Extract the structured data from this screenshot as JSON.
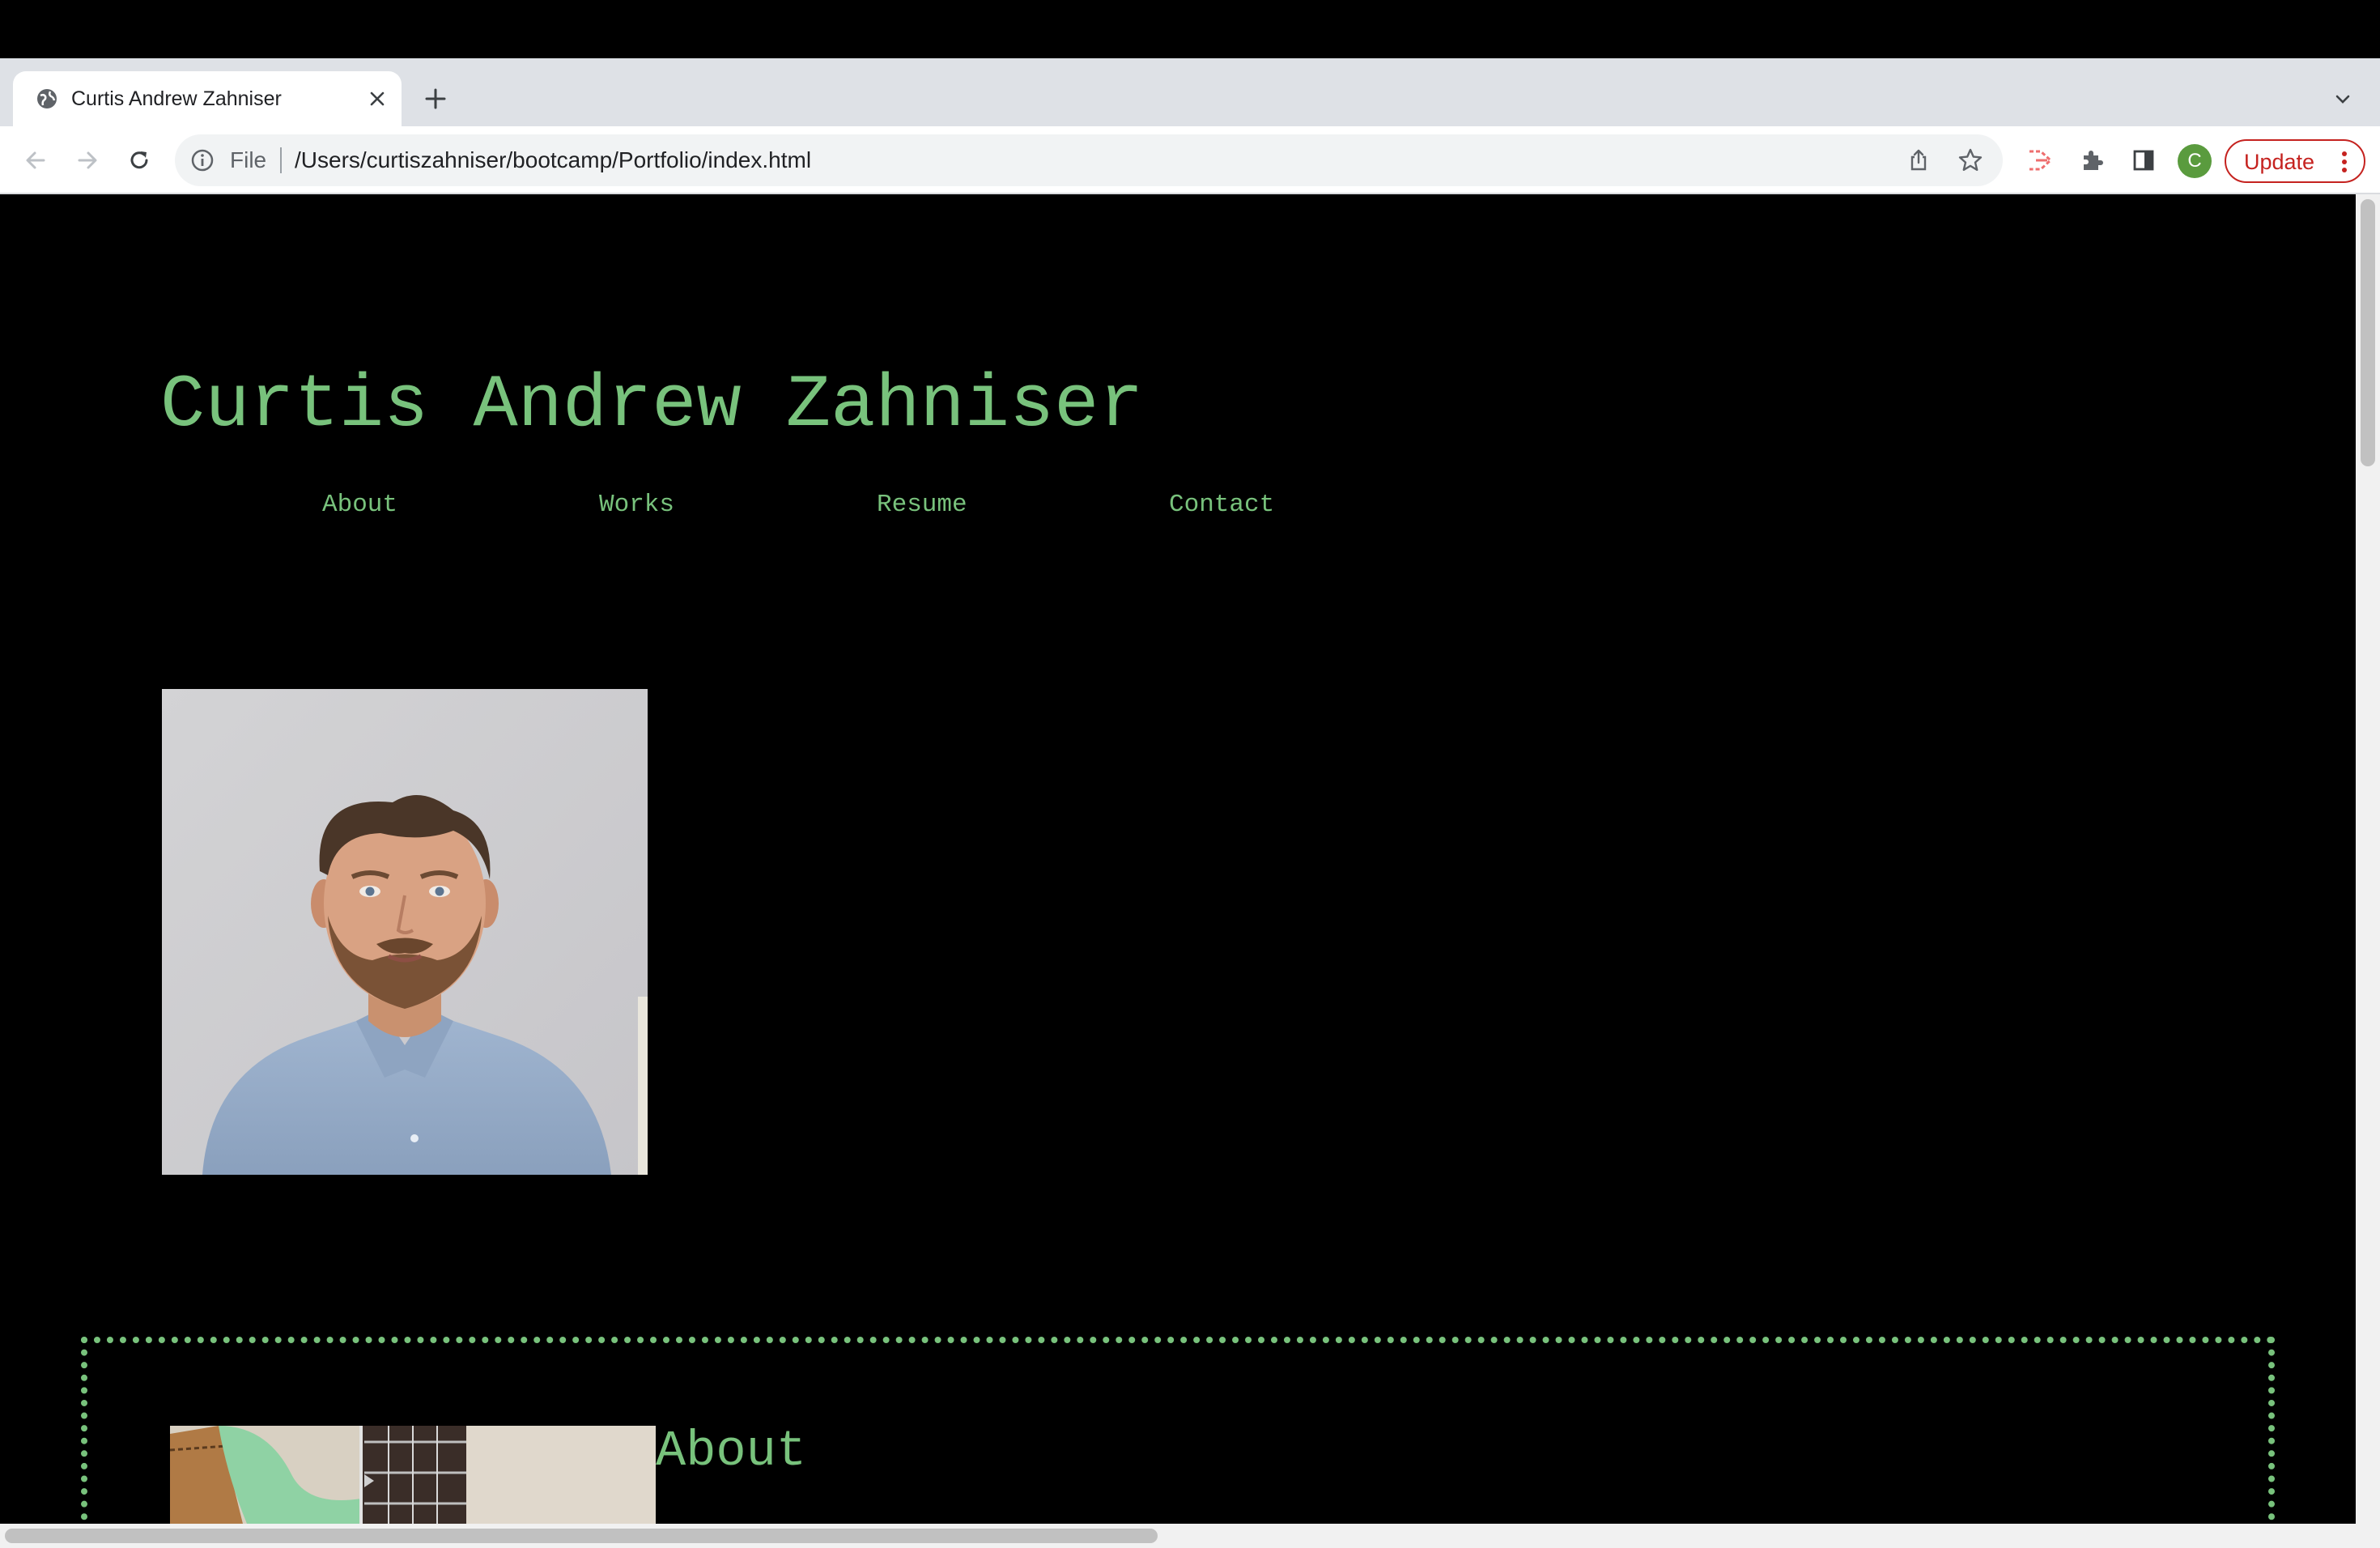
{
  "browser": {
    "tab_title": "Curtis Andrew Zahniser",
    "omnibox_scheme": "File",
    "url": "/Users/curtiszahniser/bootcamp/Portfolio/index.html",
    "profile_initial": "C",
    "update_label": "Update"
  },
  "page": {
    "site_title": "Curtis Andrew Zahniser",
    "nav": {
      "about": "About",
      "works": "Works",
      "resume": "Resume",
      "contact": "Contact"
    },
    "about_heading": "About"
  },
  "colors": {
    "accent_green": "#78c27c",
    "background": "#000000",
    "update_red": "#c5221f",
    "avatar_green": "#5a9b3e"
  },
  "icons": {
    "tab_favicon": "globe-icon",
    "tab_close": "close-icon",
    "new_tab": "plus-icon",
    "tab_search": "chevron-down-icon",
    "back": "arrow-left-icon",
    "forward": "arrow-right-icon",
    "reload": "reload-icon",
    "site_info": "info-icon",
    "share": "share-icon",
    "bookmark": "star-icon",
    "extension_cast": "cast-extension-icon",
    "extensions": "puzzle-icon",
    "side_panel": "side-panel-icon",
    "menu": "kebab-menu-icon"
  }
}
